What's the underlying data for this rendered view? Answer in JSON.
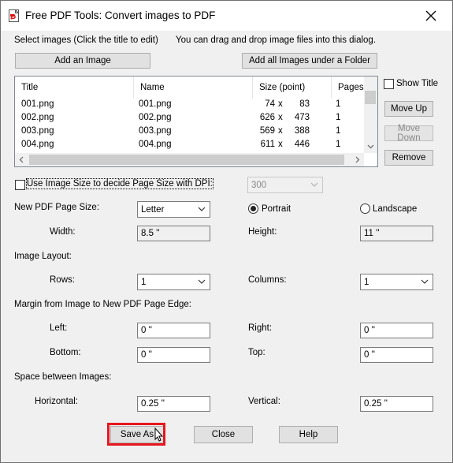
{
  "window": {
    "title": "Free PDF Tools: Convert images to PDF",
    "close_glyph": "✕"
  },
  "top": {
    "select_label": "Select images (Click the title to edit)",
    "drag_hint": "You can drag and drop image files into this dialog.",
    "add_image": "Add an Image",
    "add_folder": "Add all Images under a Folder"
  },
  "list": {
    "columns": [
      "Title",
      "Name",
      "Size (point)",
      "Pages"
    ],
    "rows": [
      {
        "title": "001.png",
        "name": "001.png",
        "w": "74",
        "x": "x",
        "h": "83",
        "pages": "1"
      },
      {
        "title": "002.png",
        "name": "002.png",
        "w": "626",
        "x": "x",
        "h": "473",
        "pages": "1"
      },
      {
        "title": "003.png",
        "name": "003.png",
        "w": "569",
        "x": "x",
        "h": "388",
        "pages": "1"
      },
      {
        "title": "004.png",
        "name": "004.png",
        "w": "611",
        "x": "x",
        "h": "446",
        "pages": "1"
      }
    ]
  },
  "side": {
    "show_title": "Show Title",
    "move_up": "Move Up",
    "move_down": "Move Down",
    "remove": "Remove"
  },
  "options": {
    "use_image_size": "Use Image Size to decide Page Size with DPI:",
    "dpi": "300",
    "page_size_label": "New PDF Page Size:",
    "page_size": "Letter",
    "portrait": "Portrait",
    "landscape": "Landscape",
    "width_label": "Width:",
    "width": "8.5 ''",
    "height_label": "Height:",
    "height": "11 ''",
    "layout_label": "Image Layout:",
    "rows_label": "Rows:",
    "rows": "1",
    "columns_label": "Columns:",
    "columns": "1",
    "margin_label": "Margin from Image to New PDF Page Edge:",
    "left_label": "Left:",
    "left": "0 ''",
    "right_label": "Right:",
    "right": "0 ''",
    "bottom_label": "Bottom:",
    "bottom": "0 ''",
    "top_label": "Top:",
    "top": "0 ''",
    "space_label": "Space between Images:",
    "horizontal_label": "Horizontal:",
    "horizontal": "0.25 ''",
    "vertical_label": "Vertical:",
    "vertical": "0.25 ''"
  },
  "footer": {
    "save_as": "Save As",
    "close": "Close",
    "help": "Help"
  },
  "colors": {
    "highlight": "#e8151d",
    "dialog_bg": "#f0f0f0",
    "button_bg": "#e1e1e1"
  }
}
